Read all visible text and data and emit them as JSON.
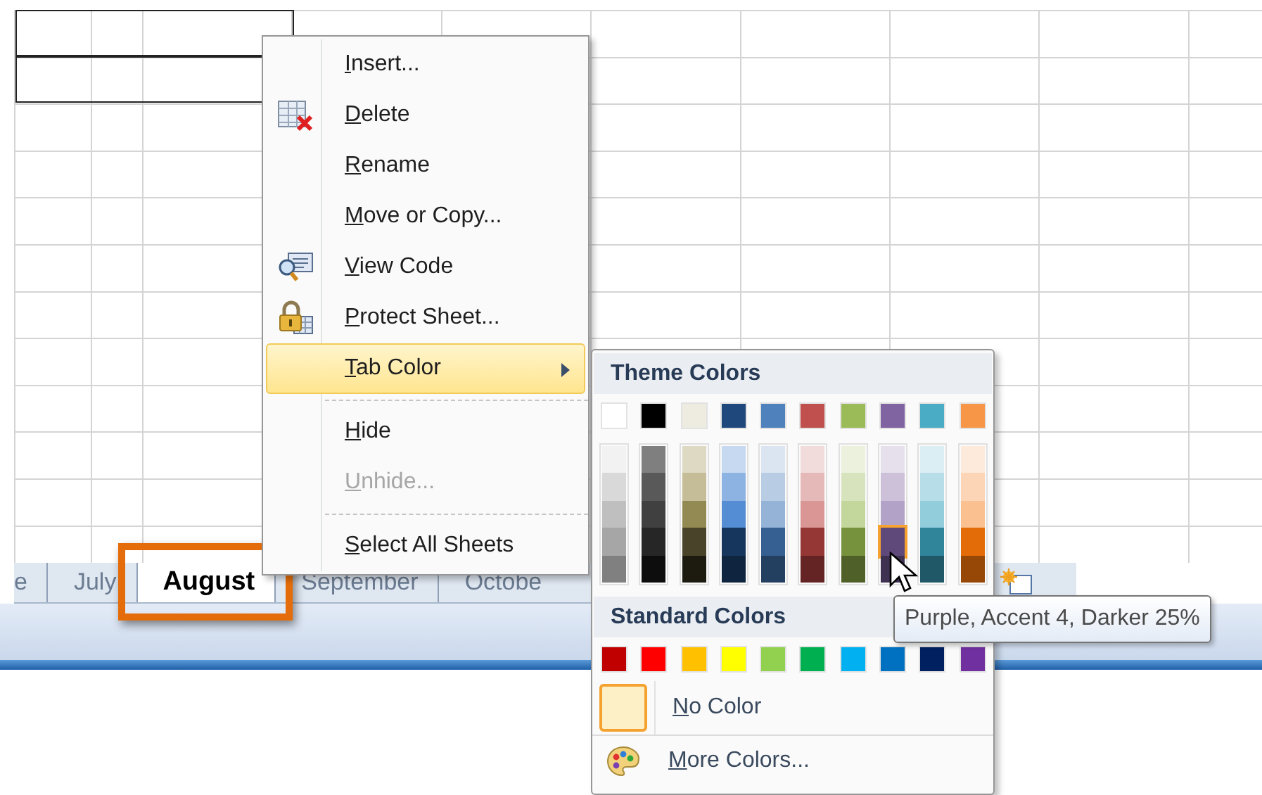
{
  "sheet_tabs": [
    {
      "label": "e",
      "selected": false
    },
    {
      "label": "July",
      "selected": false
    },
    {
      "label": "August",
      "selected": true
    },
    {
      "label": "September",
      "selected": false
    },
    {
      "label": "Octobe",
      "selected": false
    }
  ],
  "context_menu": {
    "items": [
      {
        "kind": "plain",
        "label": "Insert...",
        "disabled": false,
        "selected": false
      },
      {
        "kind": "delete",
        "label": "Delete",
        "disabled": false,
        "selected": false
      },
      {
        "kind": "plain",
        "label": "Rename",
        "disabled": false,
        "selected": false
      },
      {
        "kind": "plain",
        "label": "Move or Copy...",
        "disabled": false,
        "selected": false
      },
      {
        "kind": "code",
        "label": "View Code",
        "disabled": false,
        "selected": false
      },
      {
        "kind": "lock",
        "label": "Protect Sheet...",
        "disabled": false,
        "selected": false
      },
      {
        "kind": "submenu",
        "label": "Tab Color",
        "disabled": false,
        "selected": true
      },
      {
        "kind": "separator"
      },
      {
        "kind": "plain",
        "label": "Hide",
        "disabled": false,
        "selected": false
      },
      {
        "kind": "plain",
        "label": "Unhide...",
        "disabled": true,
        "selected": false
      },
      {
        "kind": "separator"
      },
      {
        "kind": "plain",
        "label": "Select All Sheets",
        "disabled": false,
        "selected": false
      }
    ]
  },
  "color_menu": {
    "theme_title": "Theme Colors",
    "theme_colors": [
      {
        "color": "#ffffff",
        "selected": false
      },
      {
        "color": "#000000",
        "selected": false
      },
      {
        "color": "#eeece1",
        "selected": false
      },
      {
        "color": "#1f497d",
        "selected": false
      },
      {
        "color": "#4f81bd",
        "selected": false
      },
      {
        "color": "#c0504d",
        "selected": false
      },
      {
        "color": "#9bbb59",
        "selected": false
      },
      {
        "color": "#8064a2",
        "selected": false
      },
      {
        "color": "#4bacc6",
        "selected": false
      },
      {
        "color": "#f79646",
        "selected": false
      }
    ],
    "tint_columns": [
      {
        "swatches": [
          {
            "color": "#f2f2f2",
            "selected": false
          },
          {
            "color": "#d9d9d9",
            "selected": false
          },
          {
            "color": "#bfbfbf",
            "selected": false
          },
          {
            "color": "#a6a6a6",
            "selected": false
          },
          {
            "color": "#808080",
            "selected": false
          }
        ]
      },
      {
        "swatches": [
          {
            "color": "#7f7f7f",
            "selected": false
          },
          {
            "color": "#595959",
            "selected": false
          },
          {
            "color": "#404040",
            "selected": false
          },
          {
            "color": "#262626",
            "selected": false
          },
          {
            "color": "#0d0d0d",
            "selected": false
          }
        ]
      },
      {
        "swatches": [
          {
            "color": "#ddd9c3",
            "selected": false
          },
          {
            "color": "#c4bd97",
            "selected": false
          },
          {
            "color": "#938953",
            "selected": false
          },
          {
            "color": "#494429",
            "selected": false
          },
          {
            "color": "#1d1b10",
            "selected": false
          }
        ]
      },
      {
        "swatches": [
          {
            "color": "#c6d9f0",
            "selected": false
          },
          {
            "color": "#8db3e2",
            "selected": false
          },
          {
            "color": "#548dd4",
            "selected": false
          },
          {
            "color": "#17365d",
            "selected": false
          },
          {
            "color": "#0f243e",
            "selected": false
          }
        ]
      },
      {
        "swatches": [
          {
            "color": "#dbe5f1",
            "selected": false
          },
          {
            "color": "#b8cce4",
            "selected": false
          },
          {
            "color": "#95b3d7",
            "selected": false
          },
          {
            "color": "#366092",
            "selected": false
          },
          {
            "color": "#244061",
            "selected": false
          }
        ]
      },
      {
        "swatches": [
          {
            "color": "#f2dcdb",
            "selected": false
          },
          {
            "color": "#e5b9b7",
            "selected": false
          },
          {
            "color": "#d99694",
            "selected": false
          },
          {
            "color": "#953734",
            "selected": false
          },
          {
            "color": "#632423",
            "selected": false
          }
        ]
      },
      {
        "swatches": [
          {
            "color": "#ebf1dd",
            "selected": false
          },
          {
            "color": "#d7e3bc",
            "selected": false
          },
          {
            "color": "#c3d69b",
            "selected": false
          },
          {
            "color": "#76923c",
            "selected": false
          },
          {
            "color": "#4f6128",
            "selected": false
          }
        ]
      },
      {
        "swatches": [
          {
            "color": "#e5e0ec",
            "selected": false
          },
          {
            "color": "#ccc1d9",
            "selected": false
          },
          {
            "color": "#b2a2c7",
            "selected": false
          },
          {
            "color": "#5f497a",
            "selected": true
          },
          {
            "color": "#3f3151",
            "selected": false
          }
        ]
      },
      {
        "swatches": [
          {
            "color": "#dbeef3",
            "selected": false
          },
          {
            "color": "#b7dde8",
            "selected": false
          },
          {
            "color": "#92cddc",
            "selected": false
          },
          {
            "color": "#31859b",
            "selected": false
          },
          {
            "color": "#205867",
            "selected": false
          }
        ]
      },
      {
        "swatches": [
          {
            "color": "#fdeada",
            "selected": false
          },
          {
            "color": "#fbd5b5",
            "selected": false
          },
          {
            "color": "#fac08f",
            "selected": false
          },
          {
            "color": "#e36c09",
            "selected": false
          },
          {
            "color": "#974806",
            "selected": false
          }
        ]
      }
    ],
    "standard_title": "Standard Colors",
    "standard_colors": [
      {
        "color": "#c00000",
        "selected": false
      },
      {
        "color": "#ff0000",
        "selected": false
      },
      {
        "color": "#ffc000",
        "selected": false
      },
      {
        "color": "#ffff00",
        "selected": false
      },
      {
        "color": "#92d050",
        "selected": false
      },
      {
        "color": "#00b050",
        "selected": false
      },
      {
        "color": "#00b0f0",
        "selected": false
      },
      {
        "color": "#0070c0",
        "selected": false
      },
      {
        "color": "#002060",
        "selected": false
      },
      {
        "color": "#7030a0",
        "selected": false
      }
    ],
    "no_color": {
      "label": "No Color",
      "selected": true
    },
    "more_colors": {
      "label": "More Colors..."
    }
  },
  "tooltip": {
    "text": "Purple, Accent 4, Darker 25%"
  }
}
